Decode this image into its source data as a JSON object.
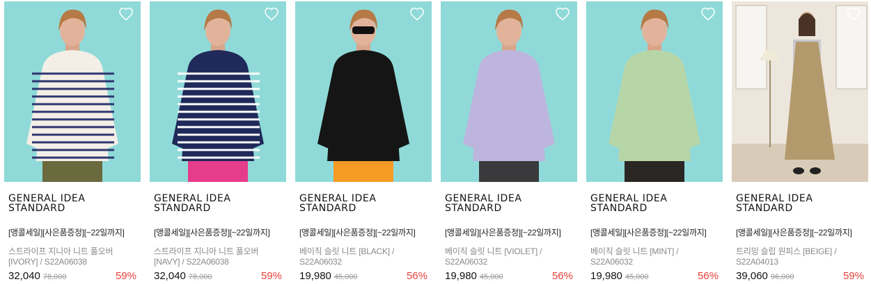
{
  "colors": {
    "accent_discount": "#e8403b",
    "thumb_teal": "#8fdad8",
    "thumb_room": "#e9e3da"
  },
  "products": [
    {
      "brand": "GENERAL IDEA STANDARD",
      "promo": "[앵콜세일][사은품증정][~22일까지]",
      "name": "스트라이프 지니아 니트 풀오버 [IVORY] / S22A06038",
      "price": "32,040",
      "original_price": "78,000",
      "discount": "59%",
      "icon": "heart-outline-icon",
      "top": "ivory-stripe",
      "bottom": "olive"
    },
    {
      "brand": "GENERAL IDEA STANDARD",
      "promo": "[앵콜세일][사은품증정][~22일까지]",
      "name": "스트라이프 지니아 니트 풀오버 [NAVY] / S22A06038",
      "price": "32,040",
      "original_price": "78,000",
      "discount": "59%",
      "icon": "heart-outline-icon",
      "top": "navy-stripe",
      "bottom": "pink"
    },
    {
      "brand": "GENERAL IDEA STANDARD",
      "promo": "[앵콜세일][사은품증정][~22일까지]",
      "name": "베이직 슬릿 니트 [BLACK] / S22A06032",
      "price": "19,980",
      "original_price": "45,000",
      "discount": "56%",
      "icon": "heart-outline-icon",
      "top": "black",
      "bottom": "orange"
    },
    {
      "brand": "GENERAL IDEA STANDARD",
      "promo": "[앵콜세일][사은품증정][~22일까지]",
      "name": "베이직 슬릿 니트 [VIOLET] / S22A06032",
      "price": "19,980",
      "original_price": "45,000",
      "discount": "56%",
      "icon": "heart-outline-icon",
      "top": "violet",
      "bottom": "charcoal"
    },
    {
      "brand": "GENERAL IDEA STANDARD",
      "promo": "[앵콜세일][사은품증정][~22일까지]",
      "name": "베이직 슬릿 니트 [MINT] / S22A06032",
      "price": "19,980",
      "original_price": "45,000",
      "discount": "56%",
      "icon": "heart-outline-icon",
      "top": "mint",
      "bottom": "black-leather"
    },
    {
      "brand": "GENERAL IDEA STANDARD",
      "promo": "[앵콜세일][사은품증정][~22일까지]",
      "name": "트리밍 슬립 원피스 [BEIGE] / S22A04013",
      "price": "39,060",
      "original_price": "96,000",
      "discount": "59%",
      "icon": "heart-outline-icon",
      "top": "beige-dress",
      "bottom": "room"
    }
  ]
}
